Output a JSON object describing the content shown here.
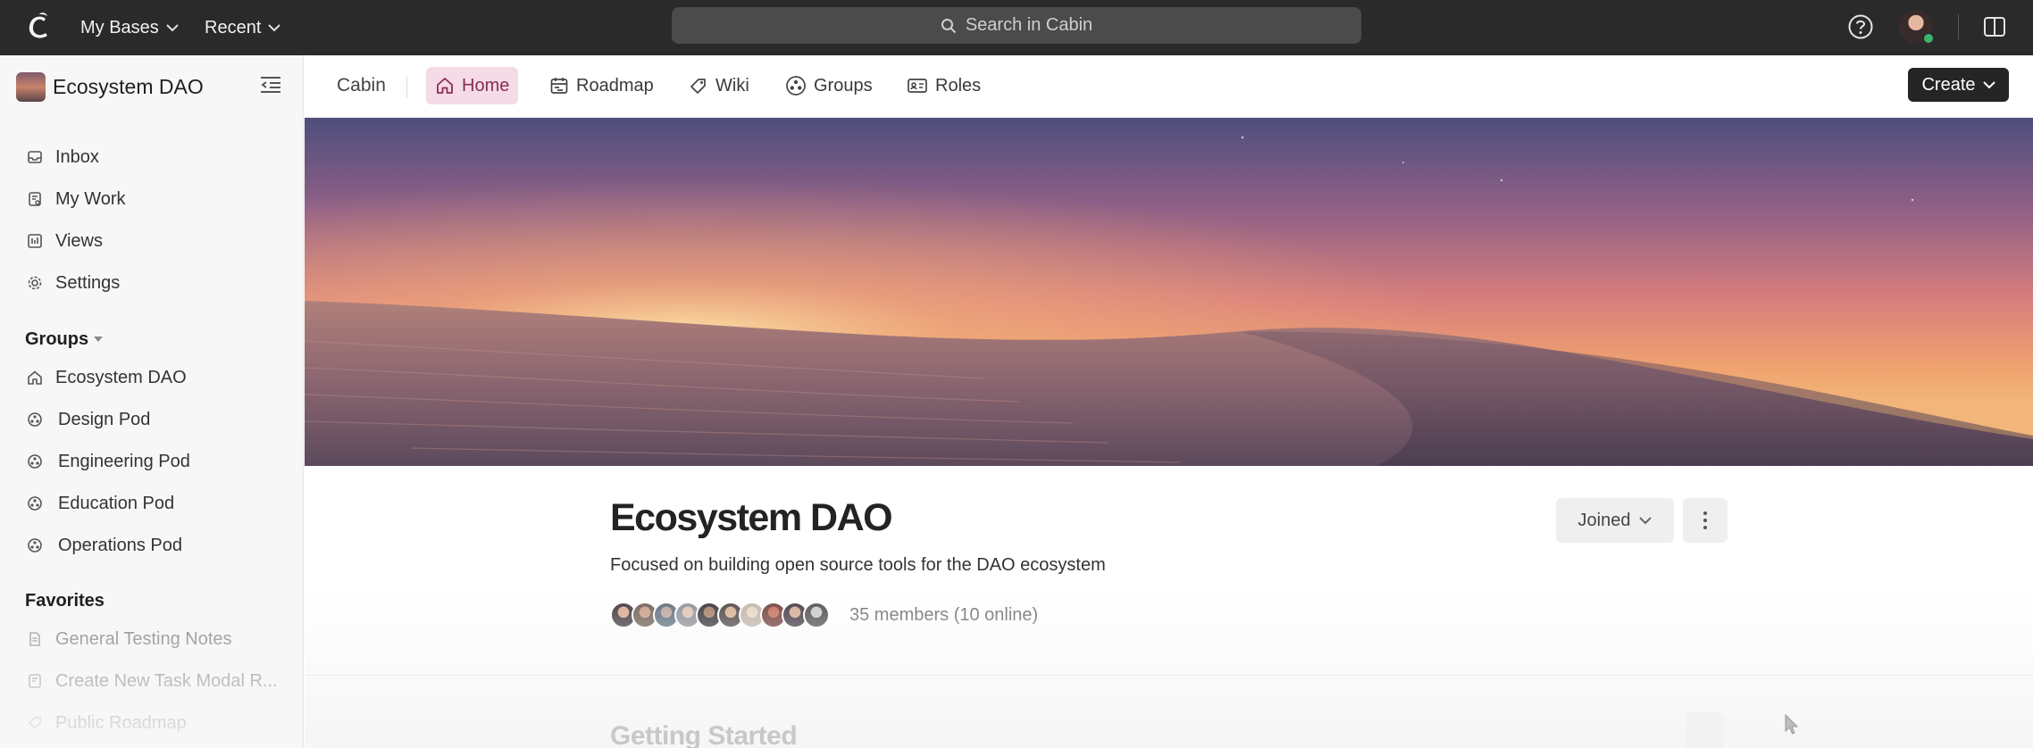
{
  "topbar": {
    "bases_label": "My Bases",
    "recent_label": "Recent",
    "search_placeholder": "Search in Cabin"
  },
  "sidebar": {
    "workspace_name": "Ecosystem DAO",
    "nav": [
      {
        "label": "Inbox",
        "icon": "inbox-icon"
      },
      {
        "label": "My Work",
        "icon": "my-work-icon"
      },
      {
        "label": "Views",
        "icon": "views-icon"
      },
      {
        "label": "Settings",
        "icon": "gear-icon"
      }
    ],
    "groups_label": "Groups",
    "groups": [
      {
        "label": "Ecosystem DAO",
        "icon": "home-icon"
      },
      {
        "label": "Design Pod",
        "icon": "group-icon"
      },
      {
        "label": "Engineering Pod",
        "icon": "group-icon"
      },
      {
        "label": "Education Pod",
        "icon": "group-icon"
      },
      {
        "label": "Operations Pod",
        "icon": "group-icon"
      }
    ],
    "favorites_label": "Favorites",
    "favorites": [
      {
        "label": "General Testing Notes",
        "icon": "document-icon"
      },
      {
        "label": "Create New Task Modal R...",
        "icon": "task-icon"
      },
      {
        "label": "Public Roadmap",
        "icon": "tag-icon"
      }
    ]
  },
  "subnav": {
    "breadcrumb": "Cabin",
    "tabs": [
      {
        "label": "Home",
        "icon": "home-icon",
        "active": true
      },
      {
        "label": "Roadmap",
        "icon": "calendar-icon",
        "active": false
      },
      {
        "label": "Wiki",
        "icon": "tag-icon",
        "active": false
      },
      {
        "label": "Groups",
        "icon": "group-icon",
        "active": false
      },
      {
        "label": "Roles",
        "icon": "id-card-icon",
        "active": false
      }
    ],
    "create_label": "Create"
  },
  "group": {
    "title": "Ecosystem DAO",
    "description": "Focused on building open source tools for the DAO ecosystem",
    "members_text": "35 members (10 online)",
    "joined_label": "Joined",
    "section_heading": "Getting Started"
  },
  "colors": {
    "topbar_bg": "#2a2a2b",
    "active_tab_bg": "#f4dbe6",
    "active_tab_text": "#8a2c55",
    "online": "#3fb36b"
  }
}
